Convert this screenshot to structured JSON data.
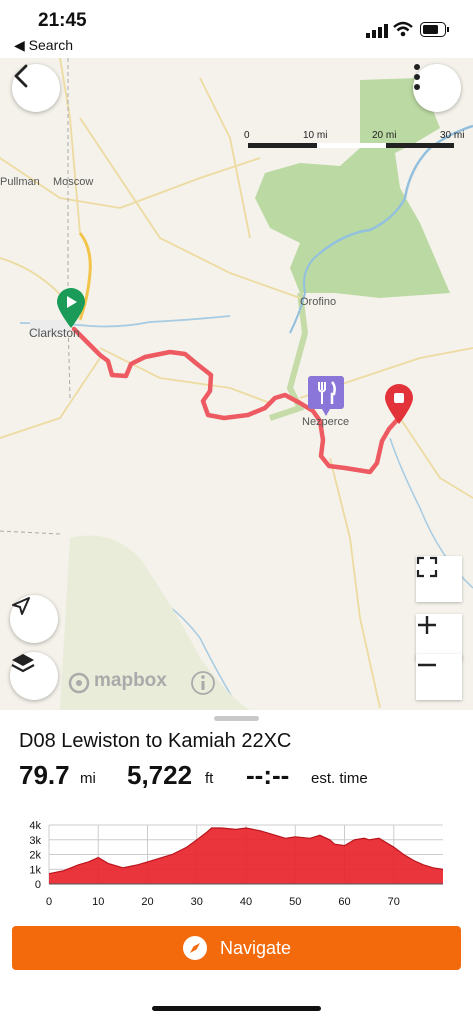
{
  "status_bar": {
    "time": "21:45",
    "back_label": "◀ Search"
  },
  "map": {
    "towns": [
      "Pullman",
      "Moscow",
      "Clarkston",
      "Orofino",
      "Nezperce"
    ],
    "scale_labels": [
      "0",
      "10 mi",
      "20 mi",
      "30 mi"
    ],
    "attribution": "mapbox",
    "route_color": "#ee5a62",
    "start_marker_color": "#1a9b58",
    "end_marker_color": "#e2333b",
    "poi_color": "#8a75d8"
  },
  "route": {
    "title": "D08 Lewiston to Kamiah 22XC",
    "distance": "79.7",
    "distance_unit": "mi",
    "climb": "5,722",
    "climb_unit": "ft",
    "time": "--:--",
    "time_unit": "est. time"
  },
  "chart_data": {
    "type": "area",
    "y_tick_labels": [
      "4k",
      "3k",
      "2k",
      "1k",
      "0"
    ],
    "x_tick_labels": [
      "0",
      "10",
      "20",
      "30",
      "40",
      "50",
      "60",
      "70"
    ],
    "ylim": [
      0,
      4000
    ],
    "xlim": [
      0,
      80
    ],
    "fill_color": "#e8242d",
    "x": [
      0,
      3,
      6,
      8,
      10,
      12,
      15,
      18,
      20,
      22,
      25,
      28,
      30,
      32,
      33,
      35,
      38,
      40,
      43,
      46,
      48,
      50,
      53,
      55,
      57,
      58,
      60,
      62,
      64,
      65,
      67,
      69,
      70,
      72,
      74,
      76,
      78,
      80
    ],
    "y": [
      700,
      900,
      1300,
      1500,
      1800,
      1400,
      1100,
      1300,
      1500,
      1700,
      2000,
      2500,
      3000,
      3500,
      3800,
      3800,
      3700,
      3800,
      3600,
      3300,
      3100,
      3200,
      3100,
      3300,
      3000,
      2700,
      2600,
      3000,
      3100,
      3000,
      3100,
      2700,
      2500,
      2000,
      1600,
      1300,
      1100,
      1000
    ]
  },
  "navigate_label": "Navigate"
}
